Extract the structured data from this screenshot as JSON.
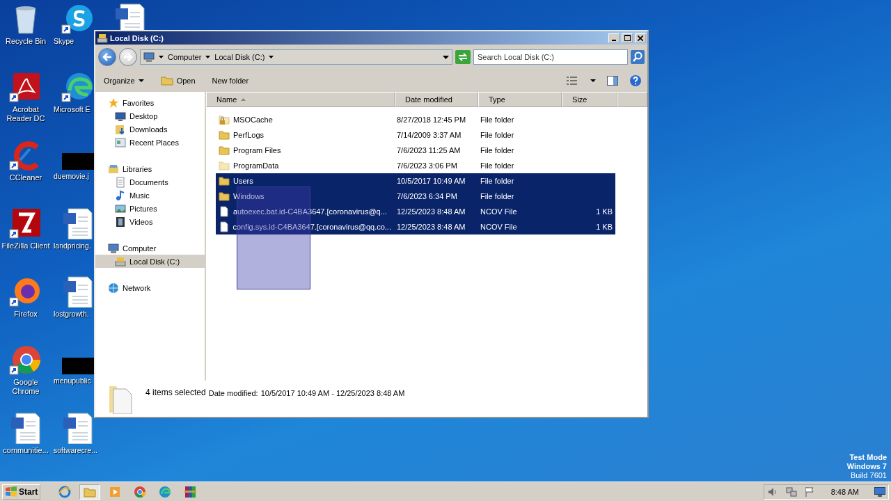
{
  "desktop": {
    "columns": [
      [
        {
          "kind": "recycle",
          "label": "Recycle Bin",
          "shortcut": false
        },
        {
          "kind": "acrobat",
          "label": "Acrobat Reader DC",
          "shortcut": true
        },
        {
          "kind": "ccleaner",
          "label": "CCleaner",
          "shortcut": true
        },
        {
          "kind": "filezilla",
          "label": "FileZilla Client",
          "shortcut": true
        },
        {
          "kind": "firefox",
          "label": "Firefox",
          "shortcut": true
        },
        {
          "kind": "chrome",
          "label": "Google Chrome",
          "shortcut": true
        },
        {
          "kind": "word",
          "label": "communitie...",
          "shortcut": false
        }
      ],
      [
        {
          "kind": "skype",
          "label": "Skype",
          "shortcut": true
        },
        {
          "kind": "edge",
          "label": "Microsoft E",
          "shortcut": true
        },
        {
          "kind": "redacted",
          "label": "duemovie.j",
          "shortcut": false
        },
        {
          "kind": "word",
          "label": "landpricing.",
          "shortcut": false
        },
        {
          "kind": "word",
          "label": "lostgrowth.",
          "shortcut": false
        },
        {
          "kind": "redacted",
          "label": "menupublic",
          "shortcut": false
        },
        {
          "kind": "word",
          "label": "softwarecre...",
          "shortcut": false
        }
      ],
      [
        {
          "kind": "word",
          "shortcut": false
        }
      ]
    ],
    "mode_lines": [
      "Test Mode",
      "Windows 7"
    ],
    "build": "Build 7601"
  },
  "window": {
    "title": "Local Disk (C:)",
    "breadcrumb": [
      "Computer",
      "Local Disk (C:)"
    ],
    "search": {
      "placeholder": "Search Local Disk (C:)"
    },
    "toolbar": [
      {
        "kind": "menu",
        "label": "Organize"
      },
      {
        "kind": "open",
        "label": "Open"
      },
      {
        "kind": "plain",
        "label": "New folder"
      }
    ],
    "nav": [
      {
        "kind": "star",
        "label": "Favorites",
        "selected": false,
        "children": [
          {
            "kind": "desktop",
            "label": "Desktop",
            "selected": false
          },
          {
            "kind": "downloads",
            "label": "Downloads",
            "selected": false
          },
          {
            "kind": "recent",
            "label": "Recent Places",
            "selected": false
          }
        ]
      },
      {
        "kind": "library",
        "label": "Libraries",
        "selected": false,
        "children": [
          {
            "kind": "documents",
            "label": "Documents",
            "selected": false
          },
          {
            "kind": "music",
            "label": "Music",
            "selected": false
          },
          {
            "kind": "pictures",
            "label": "Pictures",
            "selected": false
          },
          {
            "kind": "videos",
            "label": "Videos",
            "selected": false
          }
        ]
      },
      {
        "kind": "computer",
        "label": "Computer",
        "selected": false,
        "children": [
          {
            "kind": "disk",
            "label": "Local Disk (C:)",
            "selected": true
          }
        ]
      },
      {
        "kind": "network",
        "label": "Network",
        "selected": false
      }
    ],
    "columns": [
      {
        "label": "Name",
        "sorted": true
      },
      {
        "label": "Date modified",
        "sorted": false
      },
      {
        "label": "Type",
        "sorted": false
      },
      {
        "label": "Size",
        "sorted": false
      }
    ],
    "files": [
      {
        "kind": "locked",
        "name": "MSOCache",
        "date": "8/27/2018 12:45 PM",
        "type": "File folder",
        "selected": false
      },
      {
        "kind": "folder",
        "name": "PerfLogs",
        "date": "7/14/2009 3:37 AM",
        "type": "File folder",
        "selected": false
      },
      {
        "kind": "folder",
        "name": "Program Files",
        "date": "7/6/2023 11:25 AM",
        "type": "File folder",
        "selected": false
      },
      {
        "kind": "hidden",
        "name": "ProgramData",
        "date": "7/6/2023 3:06 PM",
        "type": "File folder",
        "selected": false
      },
      {
        "kind": "folder",
        "name": "Users",
        "date": "10/5/2017 10:49 AM",
        "type": "File folder",
        "selected": true
      },
      {
        "kind": "folder",
        "name": "Windows",
        "date": "7/6/2023 6:34 PM",
        "type": "File folder",
        "selected": true
      },
      {
        "kind": "file",
        "name": "autoexec.bat.id-C4BA3647.[coronavirus@q...",
        "date": "12/25/2023 8:48 AM",
        "type": "NCOV File",
        "size": "1 KB",
        "selected": true
      },
      {
        "kind": "file",
        "name": "config.sys.id-C4BA3647.[coronavirus@qq.co...",
        "date": "12/25/2023 8:48 AM",
        "type": "NCOV File",
        "size": "1 KB",
        "selected": true
      }
    ],
    "marquee": true,
    "details": {
      "count": "4 items selected",
      "label": "Date modified:",
      "value": "10/5/2017 10:49 AM - 12/25/2023 8:48 AM"
    }
  },
  "taskbar": {
    "start": "Start",
    "apps": [
      {
        "kind": "ie",
        "selected": false
      },
      {
        "kind": "explorer",
        "selected": true
      },
      {
        "kind": "media",
        "selected": false
      },
      {
        "kind": "chrome",
        "selected": false
      },
      {
        "kind": "edge",
        "selected": false
      },
      {
        "kind": "winrar",
        "selected": false
      }
    ],
    "time": "8:48 AM"
  }
}
